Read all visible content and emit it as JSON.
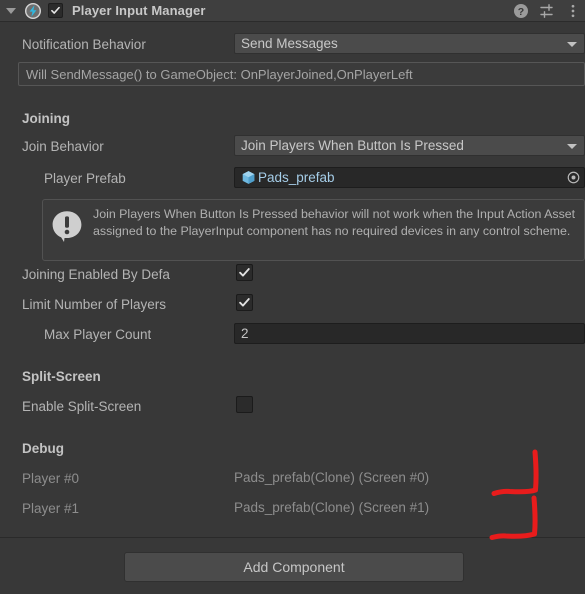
{
  "component": {
    "title": "Player Input Manager",
    "enabled_checkbox": true,
    "foldout_expanded": true,
    "icon": "input-system-bolt-icon",
    "header_buttons": [
      {
        "name": "help-icon",
        "glyph": "?"
      },
      {
        "name": "preset-sliders-icon",
        "glyph": "sliders"
      },
      {
        "name": "more-menu-icon",
        "glyph": "kebab"
      }
    ]
  },
  "notification": {
    "label": "Notification Behavior",
    "value": "Send Messages",
    "info_text": "Will SendMessage() to GameObject: OnPlayerJoined,OnPlayerLeft"
  },
  "joining": {
    "section_label": "Joining",
    "join_behavior": {
      "label": "Join Behavior",
      "value": "Join Players When Button Is Pressed"
    },
    "player_prefab": {
      "label": "Player Prefab",
      "value": "Pads_prefab",
      "icon": "prefab-cube-icon"
    },
    "warning": {
      "icon": "warning-icon",
      "text": "Join Players When Button Is Pressed behavior will not work when the Input Action Asset assigned to the PlayerInput component has no required devices in any control scheme."
    },
    "joining_enabled": {
      "label": "Joining Enabled By Defa",
      "checked": true
    },
    "limit_players": {
      "label": "Limit Number of Players",
      "checked": true
    },
    "max_player_count": {
      "label": "Max Player Count",
      "value": "2"
    }
  },
  "split_screen": {
    "section_label": "Split-Screen",
    "enable": {
      "label": "Enable Split-Screen",
      "checked": false
    }
  },
  "debug": {
    "section_label": "Debug",
    "players": [
      {
        "label": "Player #0",
        "value": "Pads_prefab(Clone) (Screen #0)"
      },
      {
        "label": "Player #1",
        "value": "Pads_prefab(Clone) (Screen #1)"
      }
    ]
  },
  "footer": {
    "add_component_label": "Add Component"
  },
  "annotation": {
    "color": "#e81c1c",
    "shape": "hand-drawn-bracket-marks"
  },
  "colors": {
    "background": "#383838",
    "header_bar": "#3f3f3f",
    "field_dark": "#282828",
    "field_mid": "#4b4b4b",
    "text": "#b4b4b4",
    "text_dim": "#8d8d8d",
    "object_ref_text": "#a5cde8",
    "annotation_red": "#e81c1c"
  }
}
